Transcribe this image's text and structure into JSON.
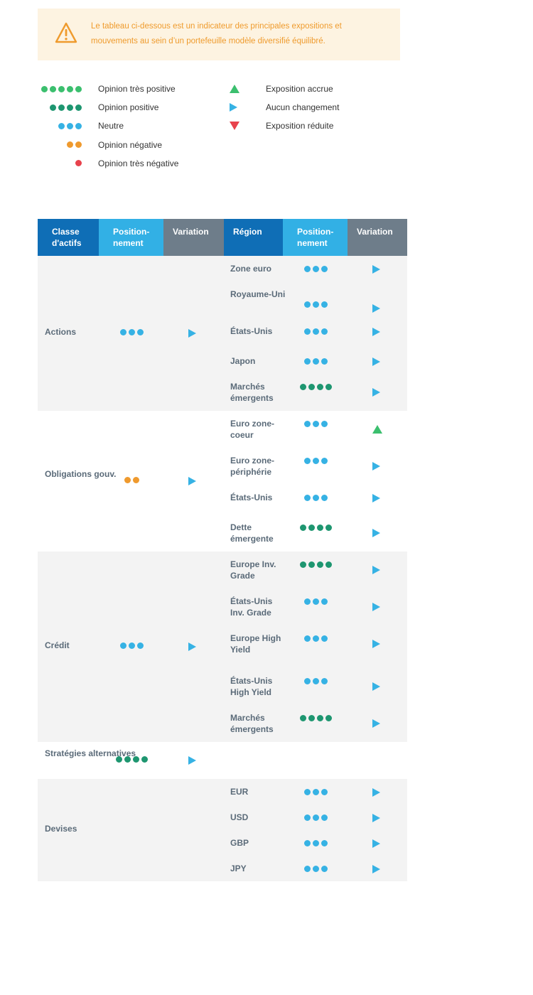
{
  "notice": {
    "text": "Le tableau ci-dessous est un indicateur des principales expositions et mouvements au sein d’un portefeuille modèle diversifié équilibré.",
    "icon": "warning-icon",
    "color": "#ef9b2d"
  },
  "legend": {
    "opinions": [
      {
        "dots": 5,
        "label": "Opinion très positive"
      },
      {
        "dots": 4,
        "label": "Opinion positive"
      },
      {
        "dots": 3,
        "label": "Neutre"
      },
      {
        "dots": 2,
        "label": "Opinion négative"
      },
      {
        "dots": 1,
        "label": "Opinion très négative"
      }
    ],
    "exposures": [
      {
        "symbol": "up",
        "label": "Exposition accrue"
      },
      {
        "symbol": "right",
        "label": "Aucun changement"
      },
      {
        "symbol": "down",
        "label": "Exposition réduite"
      }
    ]
  },
  "colors": {
    "very_positive": "#3bbf6e",
    "positive": "#1e9670",
    "neutral": "#36b2e4",
    "negative": "#ef9a2e",
    "very_negative": "#e8424c",
    "header_dark_blue": "#0f6eb6",
    "header_light_blue": "#32b0e5",
    "header_grey": "#6e7d8a"
  },
  "table": {
    "headers": [
      "Classe d'actifs",
      "Position-nement",
      "Variation",
      "Région",
      "Position-nement",
      "Variation"
    ],
    "groups": [
      {
        "name": "Actions",
        "dots": 3,
        "variation": "right",
        "regions": [
          {
            "name": "Zone euro",
            "dots": 3,
            "variation": "right"
          },
          {
            "name": "Royaume-Uni",
            "dots": 3,
            "variation": "right"
          },
          {
            "name": "États-Unis",
            "dots": 3,
            "variation": "right"
          },
          {
            "name": "Japon",
            "dots": 3,
            "variation": "right"
          },
          {
            "name": "Marchés émergents",
            "dots": 4,
            "variation": "right"
          }
        ]
      },
      {
        "name": "Obligations gouv.",
        "dots": 2,
        "variation": "right",
        "regions": [
          {
            "name": "Euro zone-coeur",
            "dots": 3,
            "variation": "up"
          },
          {
            "name": "Euro zone-périphérie",
            "dots": 3,
            "variation": "right"
          },
          {
            "name": "États-Unis",
            "dots": 3,
            "variation": "right"
          },
          {
            "name": "Dette émergente",
            "dots": 4,
            "variation": "right"
          }
        ]
      },
      {
        "name": "Crédit",
        "dots": 3,
        "variation": "right",
        "regions": [
          {
            "name": "Europe Inv. Grade",
            "dots": 4,
            "variation": "right"
          },
          {
            "name": "États-Unis Inv. Grade",
            "dots": 3,
            "variation": "right"
          },
          {
            "name": "Europe High Yield",
            "dots": 3,
            "variation": "right"
          },
          {
            "name": "États-Unis High Yield",
            "dots": 3,
            "variation": "right"
          },
          {
            "name": "Marchés émergents",
            "dots": 4,
            "variation": "right"
          }
        ]
      },
      {
        "name": "Stratégies alternatives",
        "dots": 4,
        "variation": "right",
        "regions": []
      },
      {
        "name": "Devises",
        "dots": 0,
        "variation": "",
        "regions": [
          {
            "name": "EUR",
            "dots": 3,
            "variation": "right"
          },
          {
            "name": "USD",
            "dots": 3,
            "variation": "right"
          },
          {
            "name": "GBP",
            "dots": 3,
            "variation": "right"
          },
          {
            "name": "JPY",
            "dots": 3,
            "variation": "right"
          }
        ]
      }
    ]
  }
}
